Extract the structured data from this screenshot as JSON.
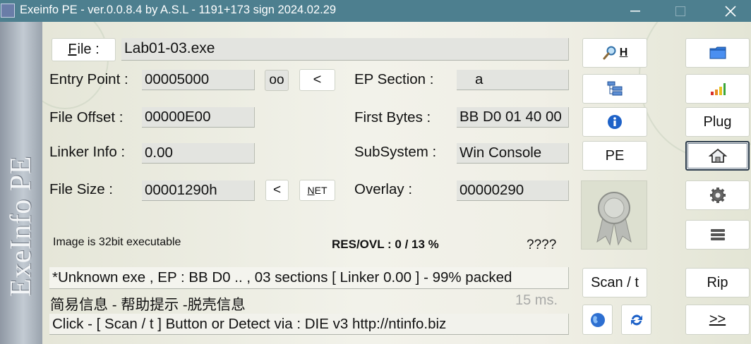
{
  "window": {
    "title": "Exeinfo PE - ver.0.0.8.4  by A.S.L -  1191+173 sign  2024.02.29",
    "controls": {
      "minimize_icon": "minimize-icon",
      "maximize_icon": "maximize-icon",
      "close_icon": "close-icon"
    }
  },
  "brand": {
    "vertical_text": "ExeInfo PE"
  },
  "file": {
    "button_label_mnemonic": "F",
    "button_label_rest": "ile :",
    "value": "Lab01-03.exe"
  },
  "entry_point": {
    "label": "Entry Point :",
    "value": "00005000",
    "oo_label": "oo",
    "back_label": "<"
  },
  "ep_section": {
    "label": "EP Section :",
    "value": "a"
  },
  "file_offset": {
    "label": "File Offset :",
    "value": "00000E00"
  },
  "first_bytes": {
    "label": "First Bytes :",
    "value": "BB D0 01 40 00"
  },
  "linker_info": {
    "label": "Linker Info :",
    "value": "0.00"
  },
  "subsystem": {
    "label": "SubSystem :",
    "value": "Win Console"
  },
  "file_size": {
    "label": "File Size :",
    "value": "00001290h",
    "back_label": "<",
    "net_mnemonic": "N",
    "net_rest": "ET"
  },
  "overlay": {
    "label": "Overlay :",
    "value": "00000290"
  },
  "status": {
    "image_info": "Image is 32bit executable",
    "res_ovl": "RES/OVL : 0 / 13 %",
    "unknown": "????"
  },
  "detection": {
    "result": "*Unknown exe , EP : BB D0 .. , 03 sections  [ Linker 0.00 ] - 99% packed",
    "chinese_info": "简易信息 - 帮助提示 -脱壳信息",
    "time": "15 ms.",
    "hint": "Click - [ Scan / t ]  Button  or Detect via : DIE v3  http://ntinfo.biz"
  },
  "tools_col1": {
    "search_h_letter": "H",
    "pe_label": "PE",
    "scan_label": "Scan / t"
  },
  "tools_col2": {
    "plug_label": "Plug",
    "rip_label": "Rip",
    "next_label": ">>"
  },
  "colors": {
    "titlebar": "#4d7f8f",
    "accent_blue": "#1e62c8",
    "field_bg": "#e3e4e0"
  }
}
